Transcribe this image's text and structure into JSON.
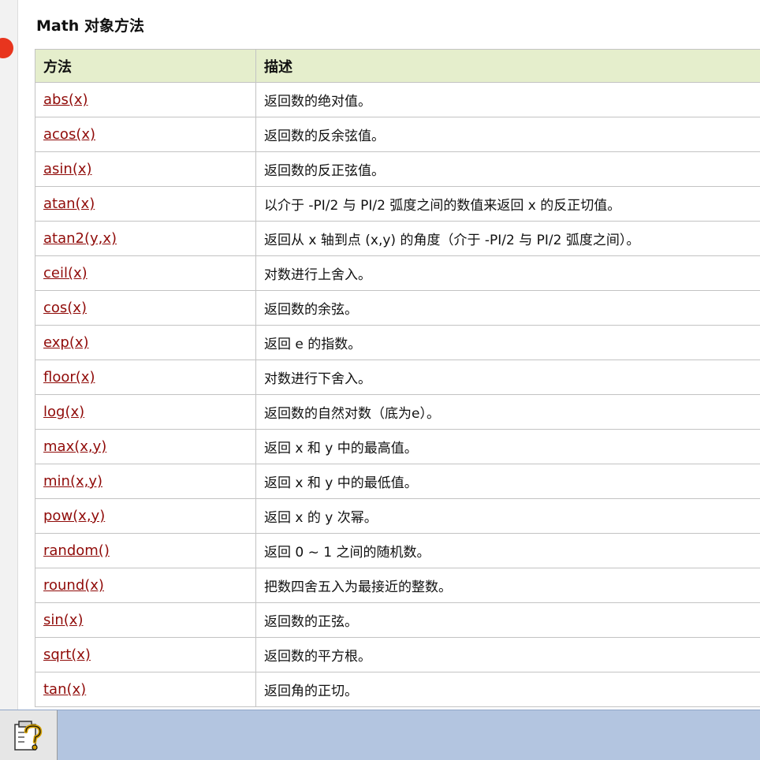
{
  "section_title": "Math 对象方法",
  "table": {
    "headers": [
      "方法",
      "描述"
    ],
    "rows": [
      {
        "method": "abs(x)",
        "desc": "返回数的绝对值。"
      },
      {
        "method": "acos(x)",
        "desc": "返回数的反余弦值。"
      },
      {
        "method": "asin(x)",
        "desc": "返回数的反正弦值。"
      },
      {
        "method": "atan(x)",
        "desc": "以介于 -PI/2 与 PI/2 弧度之间的数值来返回 x 的反正切值。"
      },
      {
        "method": "atan2(y,x)",
        "desc": "返回从 x 轴到点 (x,y) 的角度（介于 -PI/2 与 PI/2 弧度之间）。"
      },
      {
        "method": "ceil(x)",
        "desc": "对数进行上舍入。"
      },
      {
        "method": "cos(x)",
        "desc": "返回数的余弦。"
      },
      {
        "method": "exp(x)",
        "desc": "返回 e 的指数。"
      },
      {
        "method": "floor(x)",
        "desc": "对数进行下舍入。"
      },
      {
        "method": "log(x)",
        "desc": "返回数的自然对数（底为e）。"
      },
      {
        "method": "max(x,y)",
        "desc": "返回 x 和 y 中的最高值。"
      },
      {
        "method": "min(x,y)",
        "desc": "返回 x 和 y 中的最低值。"
      },
      {
        "method": "pow(x,y)",
        "desc": "返回 x 的 y 次幂。"
      },
      {
        "method": "random()",
        "desc": "返回 0 ~ 1 之间的随机数。"
      },
      {
        "method": "round(x)",
        "desc": "把数四舍五入为最接近的整数。"
      },
      {
        "method": "sin(x)",
        "desc": "返回数的正弦。"
      },
      {
        "method": "sqrt(x)",
        "desc": "返回数的平方根。"
      },
      {
        "method": "tan(x)",
        "desc": "返回角的正切。"
      }
    ]
  },
  "colors": {
    "header_bg": "#e5eecc",
    "link": "#900b09",
    "status_bar": "#b3c5e0",
    "red_dot": "#e8351e"
  },
  "icons": {
    "help": "help-icon"
  }
}
